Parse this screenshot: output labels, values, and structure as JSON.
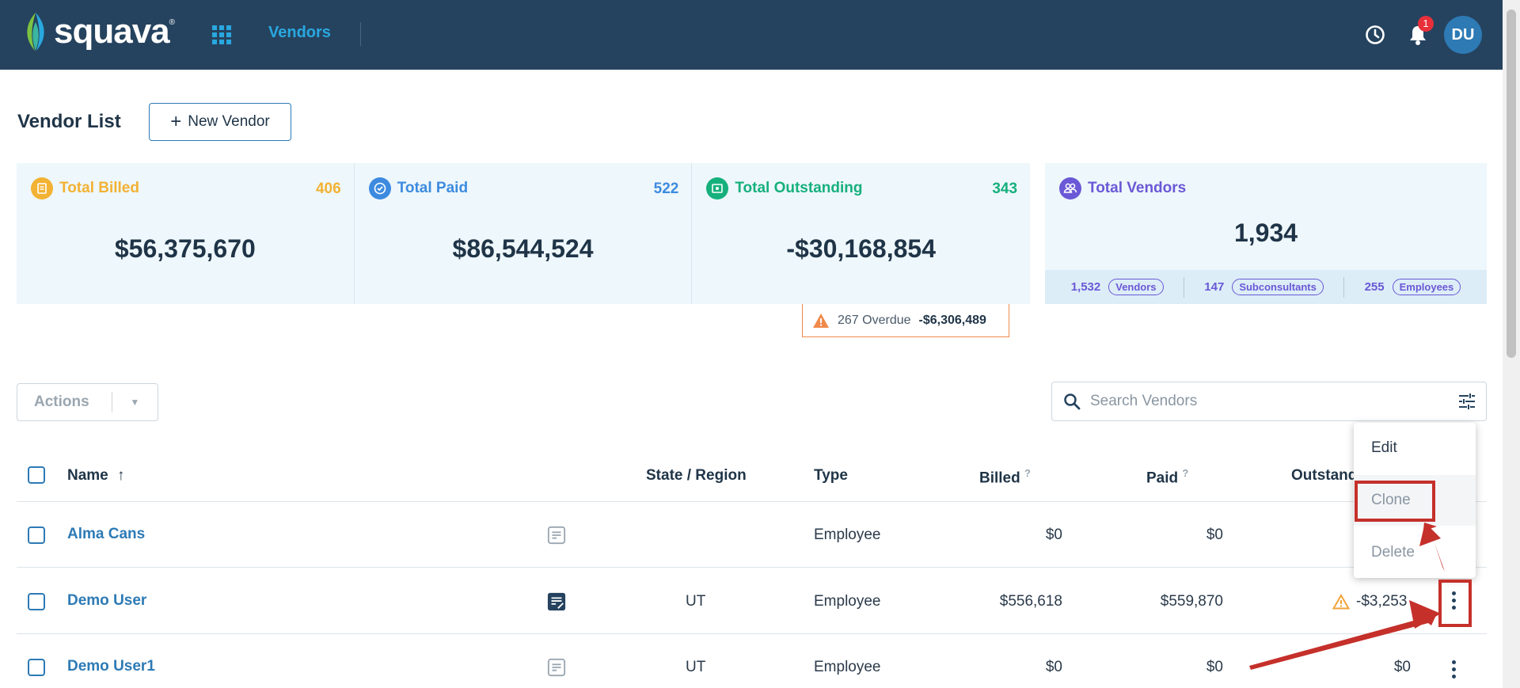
{
  "header": {
    "brand": "squava",
    "brand_mark": "®",
    "nav_label": "Vendors",
    "notification_count": "1",
    "avatar_initials": "DU"
  },
  "page": {
    "title": "Vendor List",
    "new_vendor_label": "New Vendor"
  },
  "stats": [
    {
      "label": "Total Billed",
      "count": "406",
      "value": "$56,375,670",
      "color": "#f2b233"
    },
    {
      "label": "Total Paid",
      "count": "522",
      "value": "$86,544,524",
      "color": "#3d8be0"
    },
    {
      "label": "Total Outstanding",
      "count": "343",
      "value": "-$30,168,854",
      "color": "#16b07c"
    }
  ],
  "vendors_card": {
    "label": "Total Vendors",
    "value": "1,934",
    "color": "#6a58d6",
    "breakdown": [
      {
        "count": "1,532",
        "label": "Vendors"
      },
      {
        "count": "147",
        "label": "Subconsultants"
      },
      {
        "count": "255",
        "label": "Employees"
      }
    ]
  },
  "overdue": {
    "label": "267 Overdue",
    "amount": "-$6,306,489"
  },
  "toolbar": {
    "actions_label": "Actions",
    "search_placeholder": "Search Vendors"
  },
  "table": {
    "headers": {
      "name": "Name",
      "state": "State / Region",
      "type": "Type",
      "billed": "Billed",
      "paid": "Paid",
      "outstanding": "Outstand",
      "help_mark": "?"
    },
    "rows": [
      {
        "name": "Alma Cans",
        "state": "",
        "type": "Employee",
        "billed": "$0",
        "paid": "$0",
        "outstanding": "",
        "note_filled": false
      },
      {
        "name": "Demo User",
        "state": "UT",
        "type": "Employee",
        "billed": "$556,618",
        "paid": "$559,870",
        "outstanding": "-$3,253",
        "note_filled": true
      },
      {
        "name": "Demo User1",
        "state": "UT",
        "type": "Employee",
        "billed": "$0",
        "paid": "$0",
        "outstanding": "$0",
        "note_filled": false
      }
    ]
  },
  "context_menu": {
    "items": [
      "Edit",
      "Clone",
      "Delete"
    ]
  }
}
